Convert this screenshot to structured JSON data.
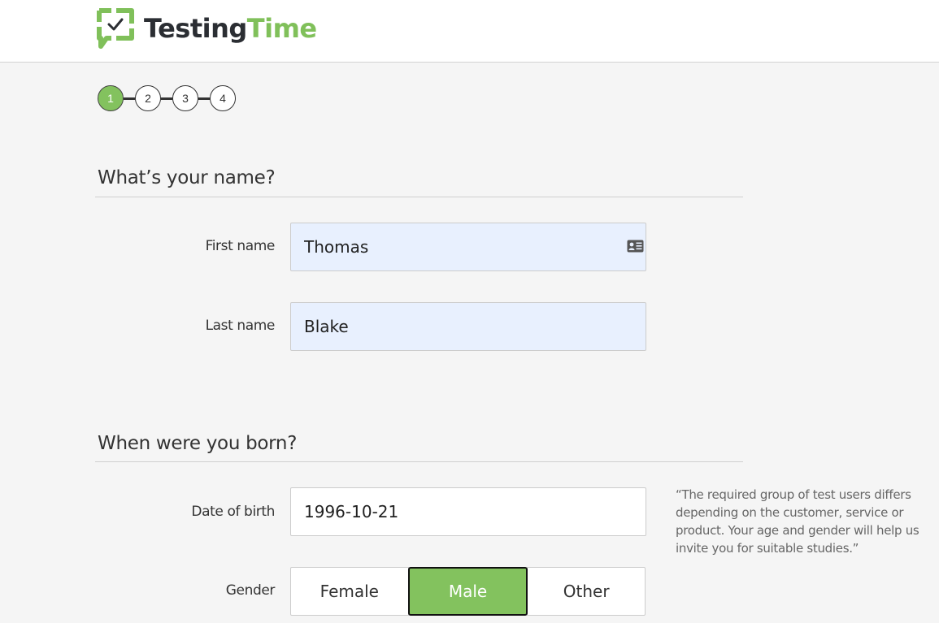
{
  "header": {
    "logo": {
      "icon": "speech-bubble-checkmark-icon",
      "text_dark": "Testing",
      "text_green": "Time"
    }
  },
  "stepper": {
    "current_step": 1,
    "steps": [
      {
        "label": "1",
        "active": true
      },
      {
        "label": "2",
        "active": false
      },
      {
        "label": "3",
        "active": false
      },
      {
        "label": "4",
        "active": false
      }
    ]
  },
  "name_section": {
    "title": "What’s your name?",
    "first_name": {
      "label": "First name",
      "value": "Thomas",
      "icon": "contact-card-icon"
    },
    "last_name": {
      "label": "Last name",
      "value": "Blake"
    }
  },
  "birth_section": {
    "title": "When were you born?",
    "date_of_birth": {
      "label": "Date of birth",
      "value": "1996-10-21"
    },
    "hint": "“The required group of test users differs depending on the customer, service or product. Your age and gender will help us invite you for suitable studies.”",
    "gender": {
      "label": "Gender",
      "selected": "Male",
      "options": [
        "Female",
        "Male",
        "Other"
      ]
    }
  },
  "colors": {
    "brand_green": "#83c25e",
    "logo_dark": "#2b2e33",
    "autofill_bg": "#e8f0fe",
    "page_bg": "#f5f5f5"
  }
}
